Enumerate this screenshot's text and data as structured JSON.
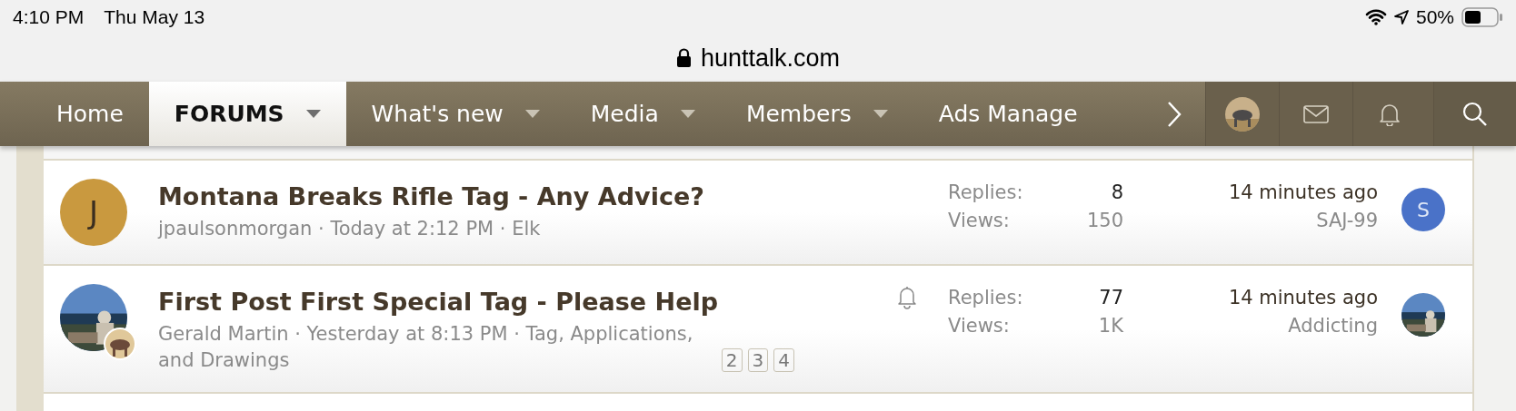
{
  "status_bar": {
    "time": "4:10 PM",
    "date": "Thu May 13",
    "battery": "50%"
  },
  "address_bar": {
    "url": "hunttalk.com"
  },
  "nav": {
    "tabs": [
      {
        "label": "Home",
        "selected": false,
        "dropdown": false
      },
      {
        "label": "FORUMS",
        "selected": true,
        "dropdown": true
      },
      {
        "label": "What's new",
        "selected": false,
        "dropdown": true
      },
      {
        "label": "Media",
        "selected": false,
        "dropdown": true
      },
      {
        "label": "Members",
        "selected": false,
        "dropdown": true
      },
      {
        "label": "Ads Manage",
        "selected": false,
        "dropdown": false
      }
    ]
  },
  "threads": [
    {
      "avatar": {
        "kind": "letter",
        "letter": "J",
        "color": "#c9993f"
      },
      "title": "Montana Breaks Rifle Tag - Any Advice?",
      "author": "jpaulsonmorgan",
      "separator": "·",
      "date": "Today at 2:12 PM",
      "forum": "Elk",
      "watched": false,
      "replies_label": "Replies:",
      "replies": "8",
      "views_label": "Views:",
      "views": "150",
      "last_time": "14 minutes ago",
      "last_user": "SAJ-99",
      "last_avatar": {
        "kind": "letter",
        "letter": "S",
        "color": "#4a72c8"
      }
    },
    {
      "title": "First Post First Special Tag - Please Help",
      "author": "Gerald Martin",
      "separator": "·",
      "date": "Yesterday at 8:13 PM",
      "forum": "Tag, Applications, and Drawings",
      "watched": true,
      "pages": [
        "2",
        "3",
        "4"
      ],
      "replies_label": "Replies:",
      "replies": "77",
      "views_label": "Views:",
      "views": "1K",
      "last_time": "14 minutes ago",
      "last_user": "Addicting"
    }
  ]
}
